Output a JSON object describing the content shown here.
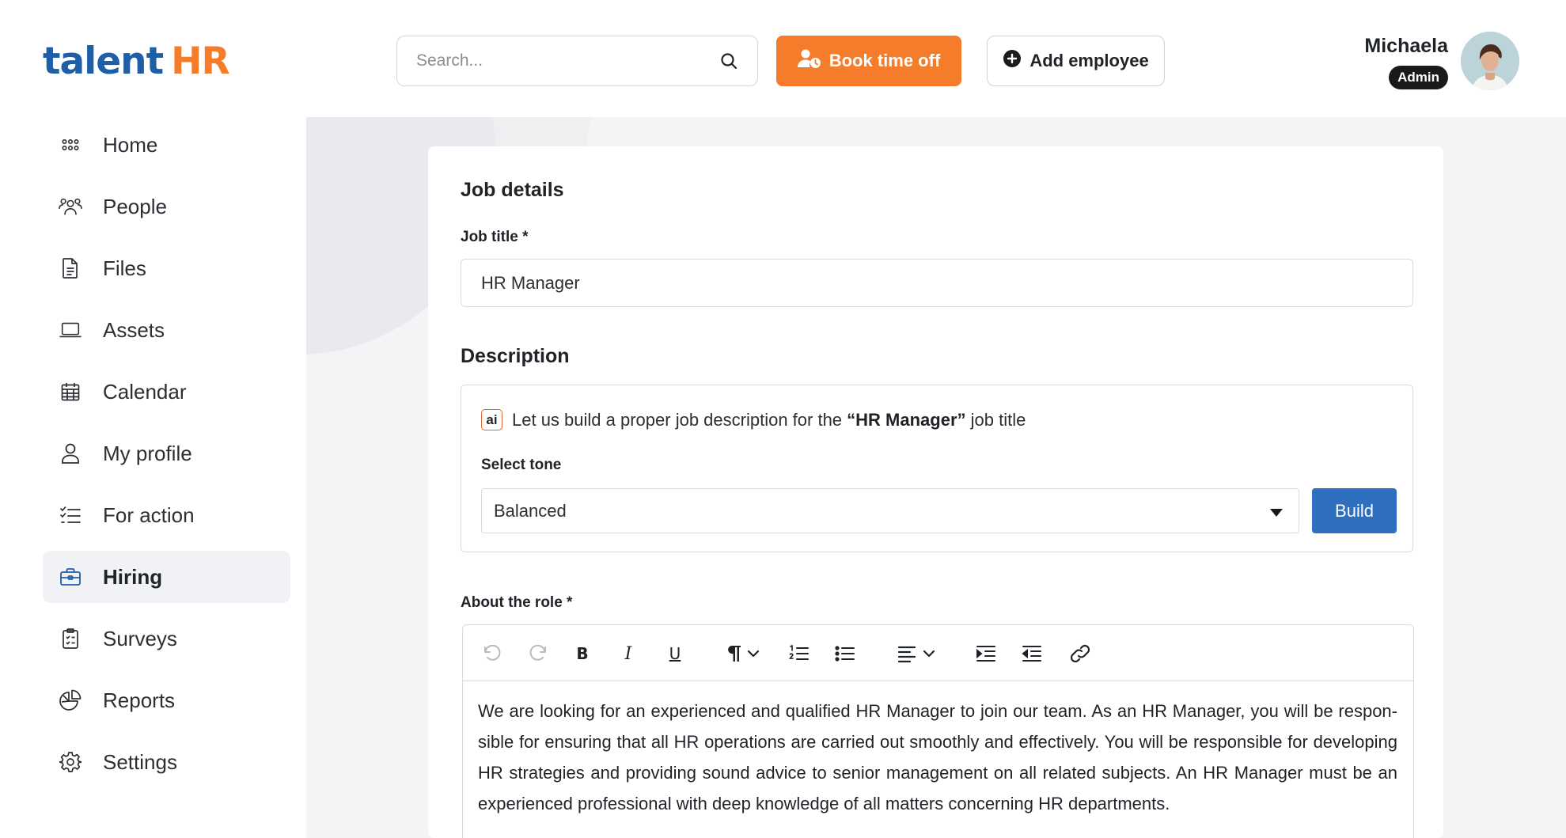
{
  "brand": {
    "logo_part1": "talent",
    "logo_part2": "HR"
  },
  "header": {
    "search_placeholder": "Search...",
    "book_label": "Book time off",
    "add_label": "Add employee"
  },
  "user": {
    "name": "Michaela",
    "role": "Admin"
  },
  "sidebar": {
    "items": [
      {
        "label": "Home",
        "icon": "grid-icon",
        "active": false
      },
      {
        "label": "People",
        "icon": "people-icon",
        "active": false
      },
      {
        "label": "Files",
        "icon": "file-icon",
        "active": false
      },
      {
        "label": "Assets",
        "icon": "laptop-icon",
        "active": false
      },
      {
        "label": "Calendar",
        "icon": "calendar-icon",
        "active": false
      },
      {
        "label": "My profile",
        "icon": "user-icon",
        "active": false
      },
      {
        "label": "For action",
        "icon": "checklist-icon",
        "active": false
      },
      {
        "label": "Hiring",
        "icon": "briefcase-icon",
        "active": true
      },
      {
        "label": "Surveys",
        "icon": "clipboard-icon",
        "active": false
      },
      {
        "label": "Reports",
        "icon": "pie-chart-icon",
        "active": false
      },
      {
        "label": "Settings",
        "icon": "gear-icon",
        "active": false
      }
    ]
  },
  "form": {
    "section_title": "Job details",
    "job_title_label": "Job title *",
    "job_title_value": "HR Manager",
    "description_title": "Description",
    "ai": {
      "badge": "ai",
      "prefix": "Let us build a proper job description for the ",
      "highlight": "“HR Manager”",
      "suffix": " job title"
    },
    "tone_label": "Select tone",
    "tone_value": "Balanced",
    "build_label": "Build",
    "about_label": "About the role *",
    "about_text": "We are looking for an experienced and qualified HR Manager to join our team. As an HR Manager, you will be respon­sible for ensuring that all HR operations are carried out smoothly and effectively. You will be responsible for devel­oping HR strategies and providing sound advice to senior management on all related subjects. An HR Manager must be an experienced professional with deep knowledge of all matters concerning HR departments."
  },
  "colors": {
    "accent_orange": "#f47c2a",
    "brand_blue": "#1f5fa8",
    "button_blue": "#2e6fbf"
  }
}
